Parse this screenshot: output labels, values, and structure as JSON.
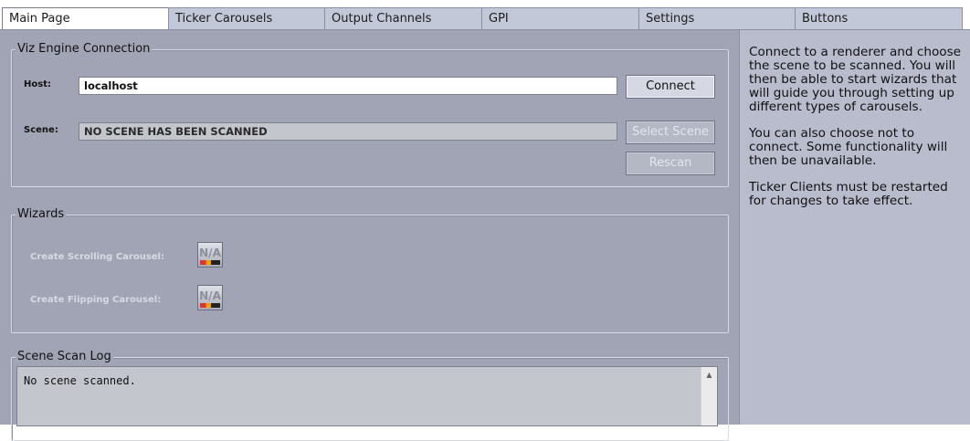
{
  "tabs": [
    {
      "label": "Main Page",
      "active": true
    },
    {
      "label": "Ticker Carousels",
      "active": false
    },
    {
      "label": "Output Channels",
      "active": false
    },
    {
      "label": "GPI",
      "active": false
    },
    {
      "label": "Settings",
      "active": false
    },
    {
      "label": "Buttons",
      "active": false
    }
  ],
  "viz_connection": {
    "legend": "Viz Engine Connection",
    "host_label": "Host:",
    "host_value": "localhost",
    "connect_label": "Connect",
    "scene_label": "Scene:",
    "scene_value": "NO SCENE HAS BEEN SCANNED",
    "select_scene_label": "Select Scene",
    "rescan_label": "Rescan"
  },
  "wizards": {
    "legend": "Wizards",
    "scrolling_label": "Create Scrolling Carousel:",
    "flipping_label": "Create Flipping Carousel:",
    "scrolling_icon": "scrolling-carousel-icon",
    "flipping_icon": "flipping-carousel-icon",
    "icon_text": "N/A"
  },
  "scan_log": {
    "legend": "Scene Scan Log",
    "text": "No scene scanned."
  },
  "side_panel": {
    "paragraph1": "Connect to a renderer and choose the scene to be scanned. You will then be able to start wizards that will guide you through setting up different types of carousels.",
    "paragraph2": "You can also choose not to connect. Some functionality will then be unavailable.",
    "paragraph3": "Ticker Clients must be restarted for changes to take effect."
  },
  "colors": {
    "main_bg": "#a1a4b4",
    "side_bg": "#b8bccc",
    "tab_bg": "#c3c8d8"
  }
}
